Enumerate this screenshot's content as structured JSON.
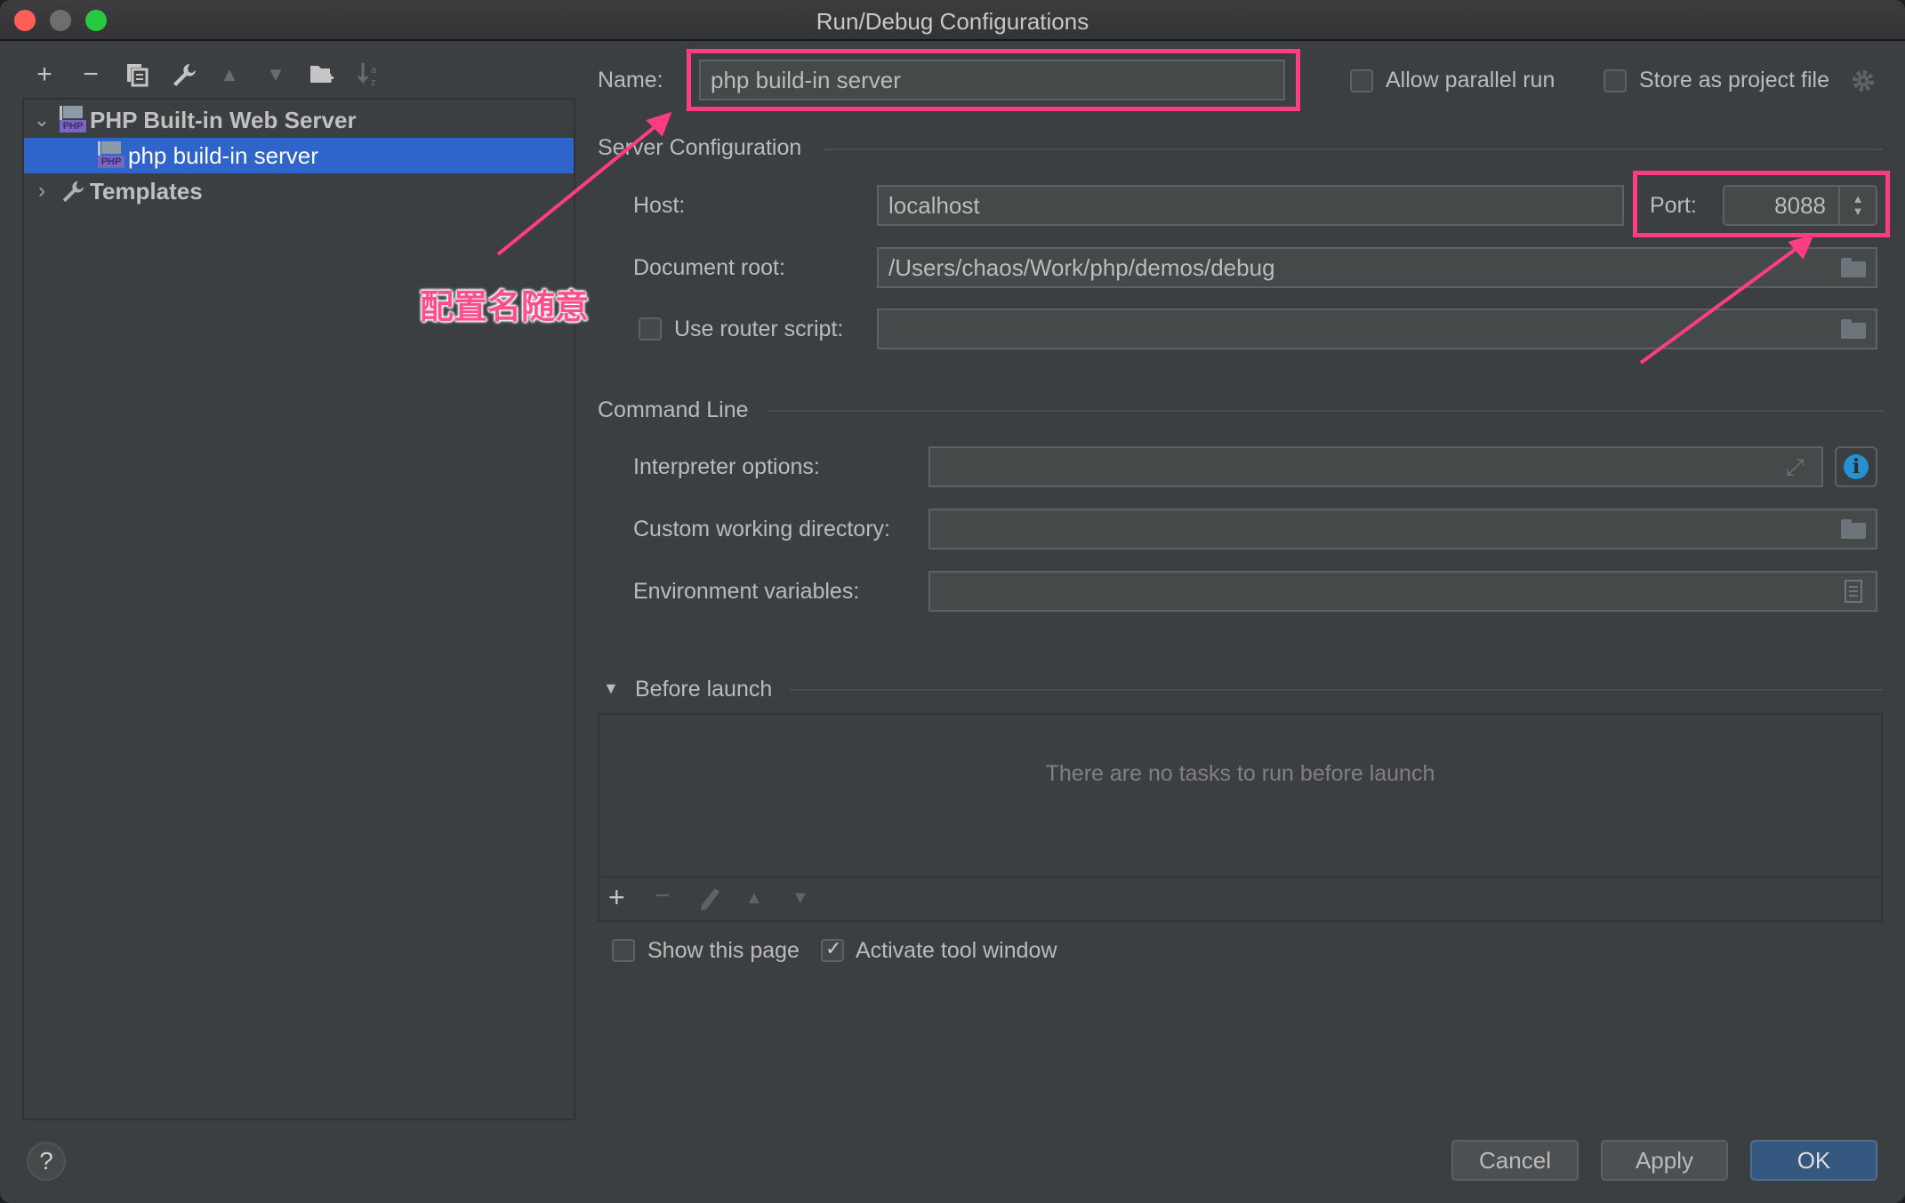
{
  "window": {
    "title": "Run/Debug Configurations",
    "traffic_lights": {
      "close": "#ff5f57",
      "minimize": "#6e6e70",
      "zoom": "#28c840"
    }
  },
  "toolbar": {
    "icons": [
      "add-icon",
      "remove-icon",
      "copy-icon",
      "wrench-icon",
      "move-up-icon",
      "move-down-icon",
      "new-folder-icon",
      "sort-icon"
    ]
  },
  "tree": {
    "items": [
      {
        "label": "PHP Built-in Web Server",
        "expanded": true,
        "bold": true
      },
      {
        "label": "php build-in server",
        "selected": true
      },
      {
        "label": "Templates",
        "expanded": false,
        "bold": true
      }
    ]
  },
  "form": {
    "name_label": "Name:",
    "name_value": "php build-in server",
    "allow_parallel_label": "Allow parallel run",
    "allow_parallel_checked": false,
    "store_project_label": "Store as project file",
    "store_project_checked": false,
    "server_config": {
      "heading": "Server Configuration",
      "host_label": "Host:",
      "host_value": "localhost",
      "port_label": "Port:",
      "port_value": "8088",
      "docroot_label": "Document root:",
      "docroot_value": "/Users/chaos/Work/php/demos/debug",
      "router_label": "Use router script:",
      "router_checked": false,
      "router_value": ""
    },
    "command_line": {
      "heading": "Command Line",
      "interpreter_label": "Interpreter options:",
      "interpreter_value": "",
      "workdir_label": "Custom working directory:",
      "workdir_value": "",
      "env_label": "Environment variables:",
      "env_value": ""
    },
    "before_launch": {
      "heading": "Before launch",
      "empty_text": "There are no tasks to run before launch",
      "show_page_label": "Show this page",
      "show_page_checked": false,
      "activate_tool_label": "Activate tool window",
      "activate_tool_checked": true
    }
  },
  "buttons": {
    "cancel": "Cancel",
    "apply": "Apply",
    "ok": "OK",
    "help": "?"
  },
  "annotation": {
    "text": "配置名随意",
    "color": "#ff3d7f"
  }
}
